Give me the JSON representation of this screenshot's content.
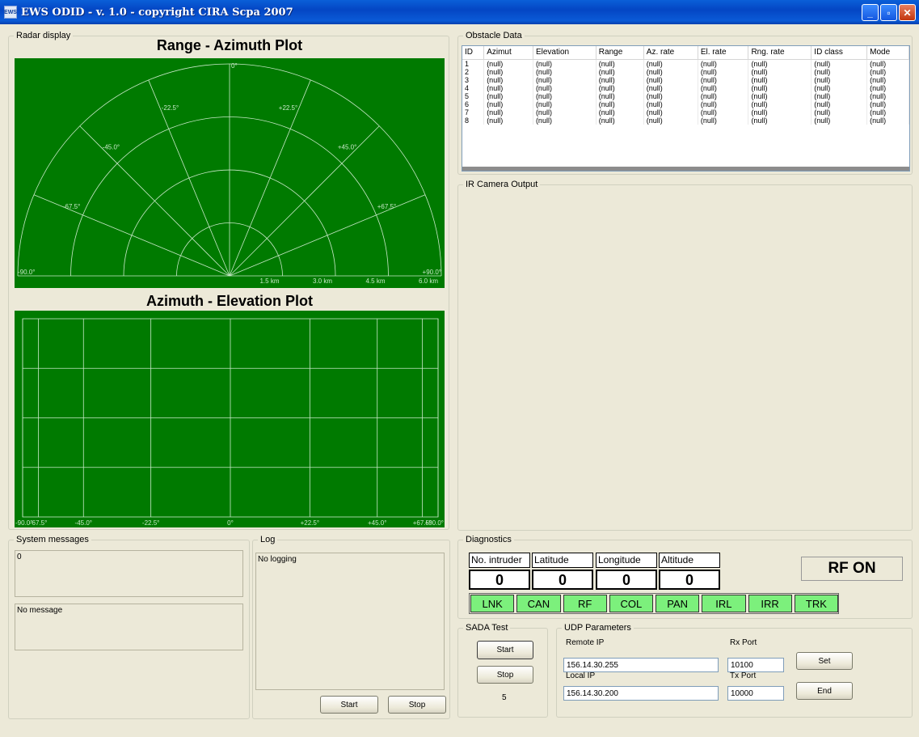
{
  "window": {
    "title": "EWS ODID - v. 1.0 - copyright CIRA Scpa 2007",
    "icon_label": "EWS",
    "controls": {
      "minimize": "_",
      "maximize": "▫",
      "close": "✕"
    }
  },
  "radar": {
    "group_label": "Radar display",
    "range_title": "Range - Azimuth Plot",
    "azimuth_title": "Azimuth - Elevation Plot",
    "range_angles": [
      "-90.0°",
      "-67.5°",
      "-45.0°",
      "-22.5°",
      "0°",
      "+22.5°",
      "+45.0°",
      "+67.5°",
      "+90.0°"
    ],
    "range_rings": [
      "1.5 km",
      "3.0 km",
      "4.5 km",
      "6.0 km"
    ],
    "az_ticks": [
      "-90.0°",
      "-67.5°",
      "-45.0°",
      "-22.5°",
      "0°",
      "+22.5°",
      "+45.0°",
      "+67.5°",
      "+90.0°"
    ],
    "plot_color": "#007a00",
    "line_color": "#c8e8c8"
  },
  "obstacle": {
    "group_label": "Obstacle Data",
    "columns": [
      "ID",
      "Azimut",
      "Elevation",
      "Range",
      "Az. rate",
      "El. rate",
      "Rng. rate",
      "ID class",
      "Mode"
    ],
    "rows": [
      [
        "1",
        "(null)",
        "(null)",
        "(null)",
        "(null)",
        "(null)",
        "(null)",
        "(null)",
        "(null)"
      ],
      [
        "2",
        "(null)",
        "(null)",
        "(null)",
        "(null)",
        "(null)",
        "(null)",
        "(null)",
        "(null)"
      ],
      [
        "3",
        "(null)",
        "(null)",
        "(null)",
        "(null)",
        "(null)",
        "(null)",
        "(null)",
        "(null)"
      ],
      [
        "4",
        "(null)",
        "(null)",
        "(null)",
        "(null)",
        "(null)",
        "(null)",
        "(null)",
        "(null)"
      ],
      [
        "5",
        "(null)",
        "(null)",
        "(null)",
        "(null)",
        "(null)",
        "(null)",
        "(null)",
        "(null)"
      ],
      [
        "6",
        "(null)",
        "(null)",
        "(null)",
        "(null)",
        "(null)",
        "(null)",
        "(null)",
        "(null)"
      ],
      [
        "7",
        "(null)",
        "(null)",
        "(null)",
        "(null)",
        "(null)",
        "(null)",
        "(null)",
        "(null)"
      ],
      [
        "8",
        "(null)",
        "(null)",
        "(null)",
        "(null)",
        "(null)",
        "(null)",
        "(null)",
        "(null)"
      ]
    ]
  },
  "ir_camera": {
    "group_label": "IR Camera Output"
  },
  "system_messages": {
    "group_label": "System messages",
    "top_text": "0",
    "bottom_text": "No message"
  },
  "log": {
    "group_label": "Log",
    "text": "No logging",
    "start_label": "Start",
    "stop_label": "Stop"
  },
  "diagnostics": {
    "group_label": "Diagnostics",
    "headers": [
      "No. intruder",
      "Latitude",
      "Longitude",
      "Altitude"
    ],
    "values": [
      "0",
      "0",
      "0",
      "0"
    ],
    "rf_status": "RF ON",
    "status_indicators": [
      "LNK",
      "CAN",
      "RF",
      "COL",
      "PAN",
      "IRL",
      "IRR",
      "TRK"
    ],
    "indicator_color": "#7cf07c"
  },
  "sada": {
    "group_label": "SADA Test",
    "start_label": "Start",
    "stop_label": "Stop",
    "counter": "5"
  },
  "udp": {
    "group_label": "UDP Parameters",
    "remote_ip_label": "Remote IP",
    "remote_ip": "156.14.30.255",
    "local_ip_label": "Local IP",
    "local_ip": "156.14.30.200",
    "rx_port_label": "Rx Port",
    "rx_port": "10100",
    "tx_port_label": "Tx Port",
    "tx_port": "10000",
    "set_label": "Set",
    "end_label": "End"
  }
}
